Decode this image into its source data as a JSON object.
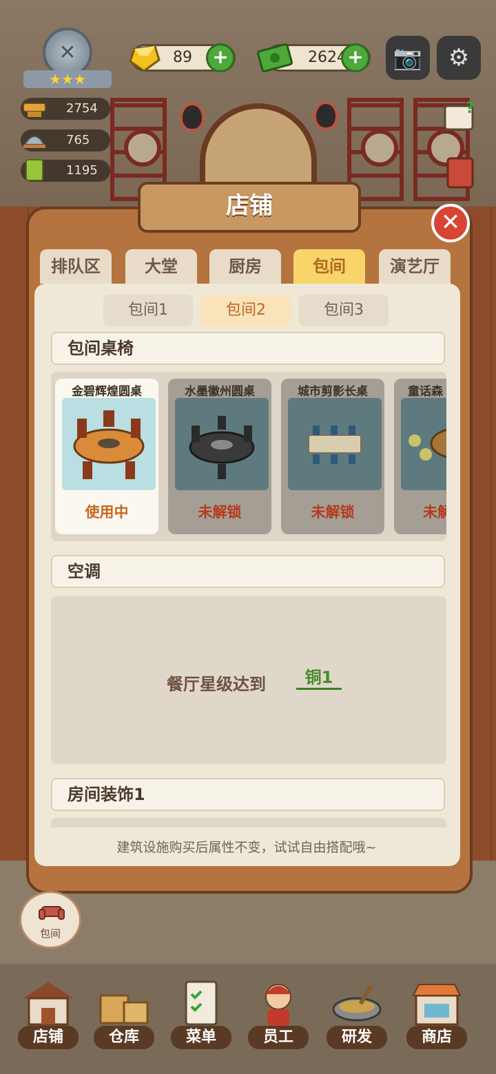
{
  "hud": {
    "gems": "89",
    "cash": "2624",
    "stats": [
      "2754",
      "765",
      "1195"
    ]
  },
  "dialog": {
    "title": "店铺",
    "tabs": [
      "排队区",
      "大堂",
      "厨房",
      "包间",
      "演艺厅"
    ],
    "active_tab": "包间",
    "subtabs": [
      "包间1",
      "包间2",
      "包间3"
    ],
    "active_subtab": "包间2"
  },
  "sections": {
    "tables": {
      "header": "包间桌椅",
      "items": [
        {
          "name": "金碧辉煌圆桌",
          "status": "使用中"
        },
        {
          "name": "水墨徽州圆桌",
          "status": "未解锁"
        },
        {
          "name": "城市剪影长桌",
          "status": "未解锁"
        },
        {
          "name": "童话森",
          "status": "未解"
        }
      ]
    },
    "ac": {
      "header": "空调",
      "requirement_text": "餐厅星级达到",
      "requirement_value": "铜1"
    },
    "decor": {
      "header": "房间装饰1"
    }
  },
  "tip": "建筑设施购买后属性不变，试试自由搭配哦~",
  "float_button": "包间",
  "nav": [
    "店铺",
    "仓库",
    "菜单",
    "员工",
    "研发",
    "商店"
  ],
  "colors": {
    "accent": "#f8d46a",
    "locked": "#b43a1c",
    "in_use": "#c9661c",
    "unlock_value": "#4a8b2c"
  }
}
